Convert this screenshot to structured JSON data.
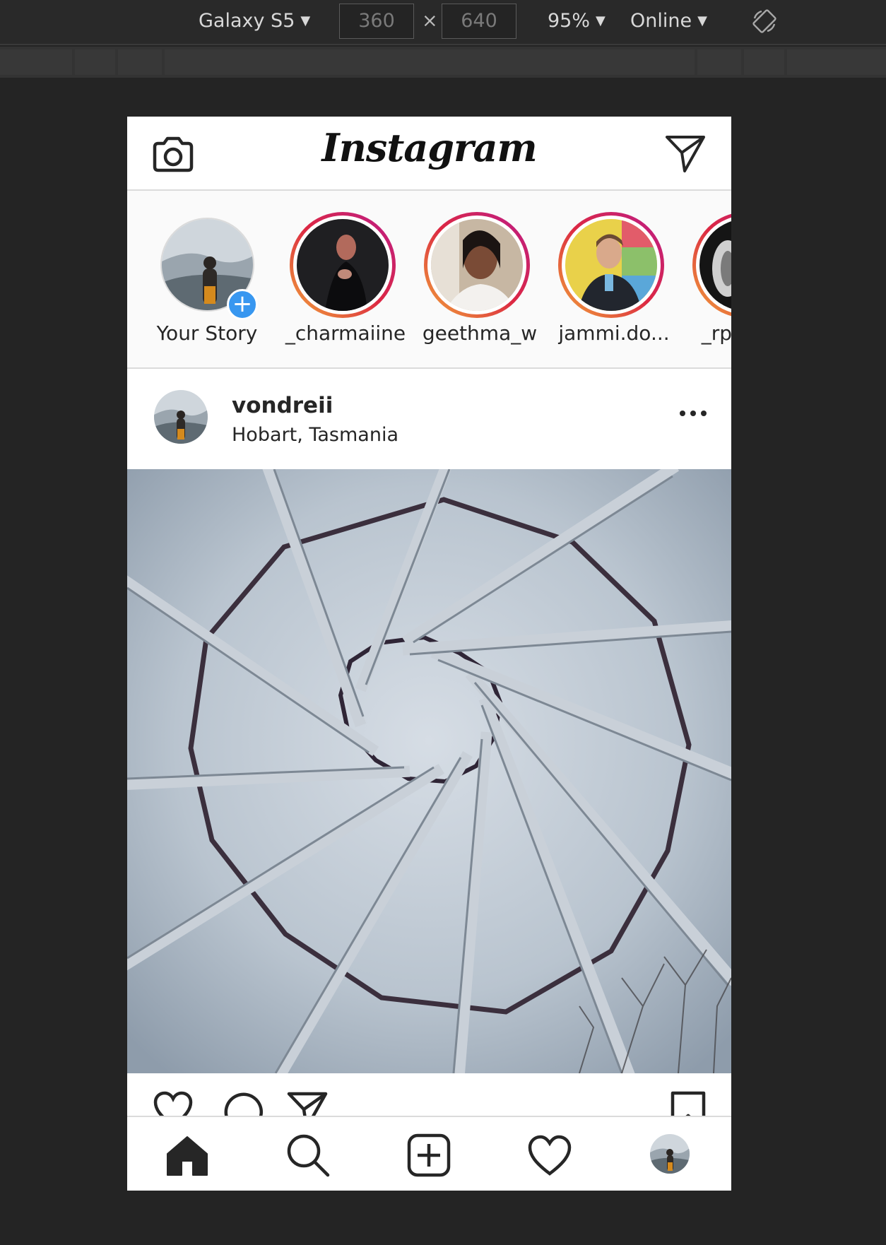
{
  "devtools": {
    "device": "Galaxy S5",
    "width": "360",
    "height": "640",
    "times": "×",
    "zoom": "95%",
    "network": "Online",
    "dropdown_glyph": "▼"
  },
  "app": {
    "logo": "Instagram"
  },
  "stories": [
    {
      "label": "Your Story"
    },
    {
      "label": "_charmaiine"
    },
    {
      "label": "geethma_w"
    },
    {
      "label": "jammi.do..."
    },
    {
      "label": "_rpa"
    }
  ],
  "post": {
    "username": "vondreii",
    "location": "Hobart, Tasmania"
  },
  "colors": {
    "story_plus": "#3897f0",
    "story_ring": "#dc2743",
    "devtools_bg": "#242424"
  },
  "icons": {
    "header_left": "camera-icon",
    "header_right": "direct-message-icon",
    "tabs": [
      "home-icon",
      "search-icon",
      "new-post-icon",
      "activity-heart-icon",
      "profile-avatar"
    ]
  }
}
